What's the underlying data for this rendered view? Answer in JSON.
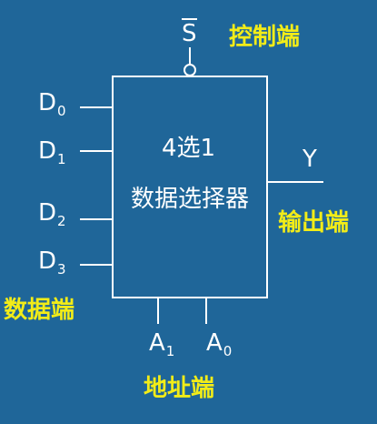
{
  "block": {
    "line1": "4选1",
    "line2": "数据选择器"
  },
  "strobe": {
    "label": "S",
    "caption": "控制端"
  },
  "inputs": [
    {
      "name": "D",
      "sub": "0"
    },
    {
      "name": "D",
      "sub": "1"
    },
    {
      "name": "D",
      "sub": "2"
    },
    {
      "name": "D",
      "sub": "3"
    }
  ],
  "inputs_caption": "数据端",
  "output": {
    "label": "Y",
    "caption": "输出端"
  },
  "address": [
    {
      "name": "A",
      "sub": "1"
    },
    {
      "name": "A",
      "sub": "0"
    }
  ],
  "address_caption": "地址端",
  "colors": {
    "background": "#1f6699",
    "lines": "#ffffff",
    "captions": "#f2ec18"
  }
}
